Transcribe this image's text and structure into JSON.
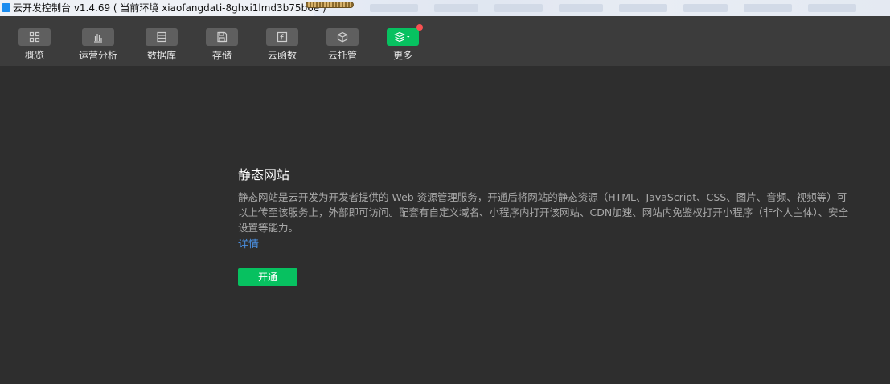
{
  "window": {
    "title": "云开发控制台 v1.4.69 ( 当前环境 xiaofangdati-8ghxi1lmd3b75b6e )"
  },
  "toolbar": {
    "items": [
      {
        "label": "概览",
        "icon": "grid-icon"
      },
      {
        "label": "运营分析",
        "icon": "bar-chart-icon"
      },
      {
        "label": "数据库",
        "icon": "database-icon"
      },
      {
        "label": "存储",
        "icon": "floppy-disk-icon"
      },
      {
        "label": "云函数",
        "icon": "function-icon"
      },
      {
        "label": "云托管",
        "icon": "cube-icon"
      },
      {
        "label": "更多",
        "icon": "layers-icon"
      }
    ]
  },
  "main": {
    "heading": "静态网站",
    "description": "静态网站是云开发为开发者提供的 Web 资源管理服务，开通后将网站的静态资源（HTML、JavaScript、CSS、图片、音频、视频等）可以上传至该服务上，外部即可访问。配套有自定义域名、小程序内打开该网站、CDN加速、网站内免鉴权打开小程序（非个人主体）、安全设置等能力。",
    "detail_link": "详情",
    "activate_button": "开通"
  },
  "colors": {
    "accent_green": "#07c160",
    "link_blue": "#4a90e2",
    "badge_red": "#fa5151",
    "toolbar_bg": "#3c3c3c",
    "main_bg": "#2e2e2e"
  }
}
